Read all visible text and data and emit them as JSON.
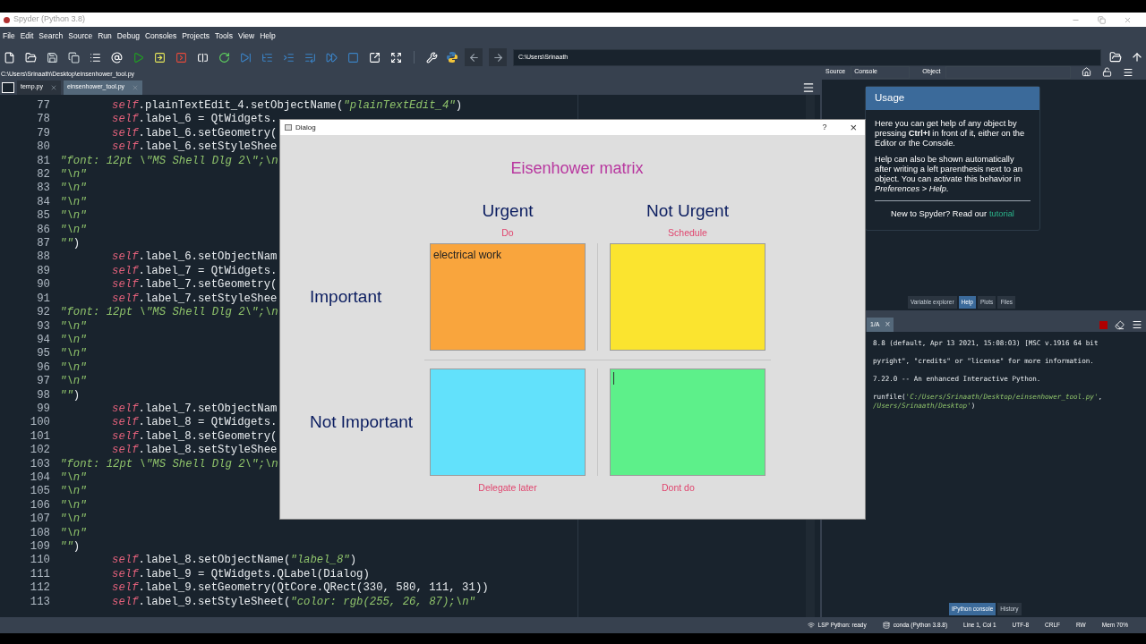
{
  "window": {
    "title": "Spyder (Python 3.8)"
  },
  "menu": [
    "File",
    "Edit",
    "Search",
    "Source",
    "Run",
    "Debug",
    "Consoles",
    "Projects",
    "Tools",
    "View",
    "Help"
  ],
  "working_directory": "C:\\Users\\Srinaath",
  "file_path": "C:\\Users\\Srinaath\\Desktop\\einsenhower_tool.py",
  "editor_tabs": [
    {
      "label": "temp.py",
      "selected": false
    },
    {
      "label": "einsenhower_tool.py",
      "selected": true
    }
  ],
  "code_lines": [
    {
      "number": "77",
      "kind": "statement",
      "receiver": "self",
      "code": ".plainTextEdit_4.setObjectName(",
      "string": "\"plainTextEdit_4\"",
      "tail": ")"
    },
    {
      "number": "78",
      "kind": "statement",
      "receiver": "self",
      "code": ".label_6 = QtWidgets."
    },
    {
      "number": "79",
      "kind": "statement",
      "receiver": "self",
      "code": ".label_6.setGeometry("
    },
    {
      "number": "80",
      "kind": "statement",
      "receiver": "self",
      "code": ".label_6.setStyleShee"
    },
    {
      "number": "81",
      "kind": "string",
      "string": "\"font: 12pt \\\"MS Shell Dlg 2\\\";\\n"
    },
    {
      "number": "82",
      "kind": "string",
      "string": "\"\\n\""
    },
    {
      "number": "83",
      "kind": "string",
      "string": "\"\\n\""
    },
    {
      "number": "84",
      "kind": "string",
      "string": "\"\\n\""
    },
    {
      "number": "85",
      "kind": "string",
      "string": "\"\\n\""
    },
    {
      "number": "86",
      "kind": "string",
      "string": "\"\\n\""
    },
    {
      "number": "87",
      "kind": "string",
      "string": "\"\"",
      "tail": ")"
    },
    {
      "number": "88",
      "kind": "statement",
      "receiver": "self",
      "code": ".label_6.setObjectNam"
    },
    {
      "number": "89",
      "kind": "statement",
      "receiver": "self",
      "code": ".label_7 = QtWidgets."
    },
    {
      "number": "90",
      "kind": "statement",
      "receiver": "self",
      "code": ".label_7.setGeometry("
    },
    {
      "number": "91",
      "kind": "statement",
      "receiver": "self",
      "code": ".label_7.setStyleShee"
    },
    {
      "number": "92",
      "kind": "string",
      "string": "\"font: 12pt \\\"MS Shell Dlg 2\\\";\\n"
    },
    {
      "number": "93",
      "kind": "string",
      "string": "\"\\n\""
    },
    {
      "number": "94",
      "kind": "string",
      "string": "\"\\n\""
    },
    {
      "number": "95",
      "kind": "string",
      "string": "\"\\n\""
    },
    {
      "number": "96",
      "kind": "string",
      "string": "\"\\n\""
    },
    {
      "number": "97",
      "kind": "string",
      "string": "\"\\n\""
    },
    {
      "number": "98",
      "kind": "string",
      "string": "\"\"",
      "tail": ")"
    },
    {
      "number": "99",
      "kind": "statement",
      "receiver": "self",
      "code": ".label_7.setObjectNam"
    },
    {
      "number": "100",
      "kind": "statement",
      "receiver": "self",
      "code": ".label_8 = QtWidgets."
    },
    {
      "number": "101",
      "kind": "statement",
      "receiver": "self",
      "code": ".label_8.setGeometry("
    },
    {
      "number": "102",
      "kind": "statement",
      "receiver": "self",
      "code": ".label_8.setStyleShee"
    },
    {
      "number": "103",
      "kind": "string",
      "string": "\"font: 12pt \\\"MS Shell Dlg 2\\\";\\n"
    },
    {
      "number": "104",
      "kind": "string",
      "string": "\"\\n\""
    },
    {
      "number": "105",
      "kind": "string",
      "string": "\"\\n\""
    },
    {
      "number": "106",
      "kind": "string",
      "string": "\"\\n\""
    },
    {
      "number": "107",
      "kind": "string",
      "string": "\"\\n\""
    },
    {
      "number": "108",
      "kind": "string",
      "string": "\"\\n\""
    },
    {
      "number": "109",
      "kind": "string",
      "string": "\"\"",
      "tail": ")"
    },
    {
      "number": "110",
      "kind": "statement",
      "receiver": "self",
      "code": ".label_8.setObjectName(",
      "string": "\"label_8\"",
      "tail": ")"
    },
    {
      "number": "111",
      "kind": "statement",
      "receiver": "self",
      "code": ".label_9 = QtWidgets.QLabel(Dialog)"
    },
    {
      "number": "112",
      "kind": "statement",
      "receiver": "self",
      "code": ".label_9.setGeometry(QtCore.QRect(330, 580, 111, 31))"
    },
    {
      "number": "113",
      "kind": "statement",
      "receiver": "self",
      "code": ".label_9.setStyleSheet(",
      "string": "\"color: rgb(255, 26, 87);\\n\""
    }
  ],
  "help_pane": {
    "source_label": "Source",
    "source_value": "Console",
    "object_label": "Object",
    "usage_title": "Usage",
    "paragraphs": [
      "Here you can get help of any object by pressing **Ctrl+I** in front of it, either on the Editor or the Console.",
      "Help can also be shown automatically after writing a left parenthesis next to an object. You can activate this behavior in *Preferences > Help*."
    ],
    "footer_text": "New to Spyder? Read our",
    "footer_link": "tutorial",
    "tabs": [
      {
        "label": "Variable explorer",
        "selected": false
      },
      {
        "label": "Help",
        "selected": true
      },
      {
        "label": "Plots",
        "selected": false
      },
      {
        "label": "Files",
        "selected": false
      }
    ]
  },
  "console_pane": {
    "tab": "1/A",
    "tab_close": "×",
    "lines": [
      {
        "code": "8.8 (default, Apr 13 2021, 15:08:03) [MSC v.1916 64 bit"
      },
      {
        "code": "pyright\", \"credits\" or \"license\" for more information."
      },
      {
        "code": "7.22.0 -- An enhanced Interactive Python."
      },
      {
        "code": "runfile(",
        "string": "'C:/Users/Srinaath/Desktop/einsenhower_tool.py'",
        "tail": ","
      },
      {
        "string": "/Users/Srinaath/Desktop'",
        "tail": ")"
      }
    ],
    "tabs": [
      {
        "label": "IPython console",
        "selected": true
      },
      {
        "label": "History",
        "selected": false
      }
    ]
  },
  "status_bar": [
    {
      "kind": "lsp",
      "text": "LSP Python: ready"
    },
    {
      "kind": "conda",
      "text": "conda (Python 3.8.8)"
    },
    {
      "kind": "plain",
      "text": "Line 1, Col 1"
    },
    {
      "kind": "plain",
      "text": "UTF-8"
    },
    {
      "kind": "plain",
      "text": "CRLF"
    },
    {
      "kind": "plain",
      "text": "RW"
    },
    {
      "kind": "plain",
      "text": "Mem 70%"
    }
  ],
  "dialog": {
    "title": "Dialog",
    "help": "?",
    "close": "×",
    "heading": "Eisenhower matrix",
    "columns": [
      {
        "title": "Urgent",
        "action": "Do"
      },
      {
        "title": "Not Urgent",
        "action": "Schedule"
      }
    ],
    "rows": [
      "Important",
      "Not Important"
    ],
    "quadrants": [
      {
        "color": "#f9a53d",
        "text": "electrical work",
        "focused": false
      },
      {
        "color": "#fbe42f",
        "focused": false
      },
      {
        "color": "#62e1fb",
        "focused": false
      },
      {
        "color": "#5df08a",
        "focused": true
      }
    ],
    "bottom_labels": [
      "Delegate later",
      "Dont do"
    ]
  }
}
